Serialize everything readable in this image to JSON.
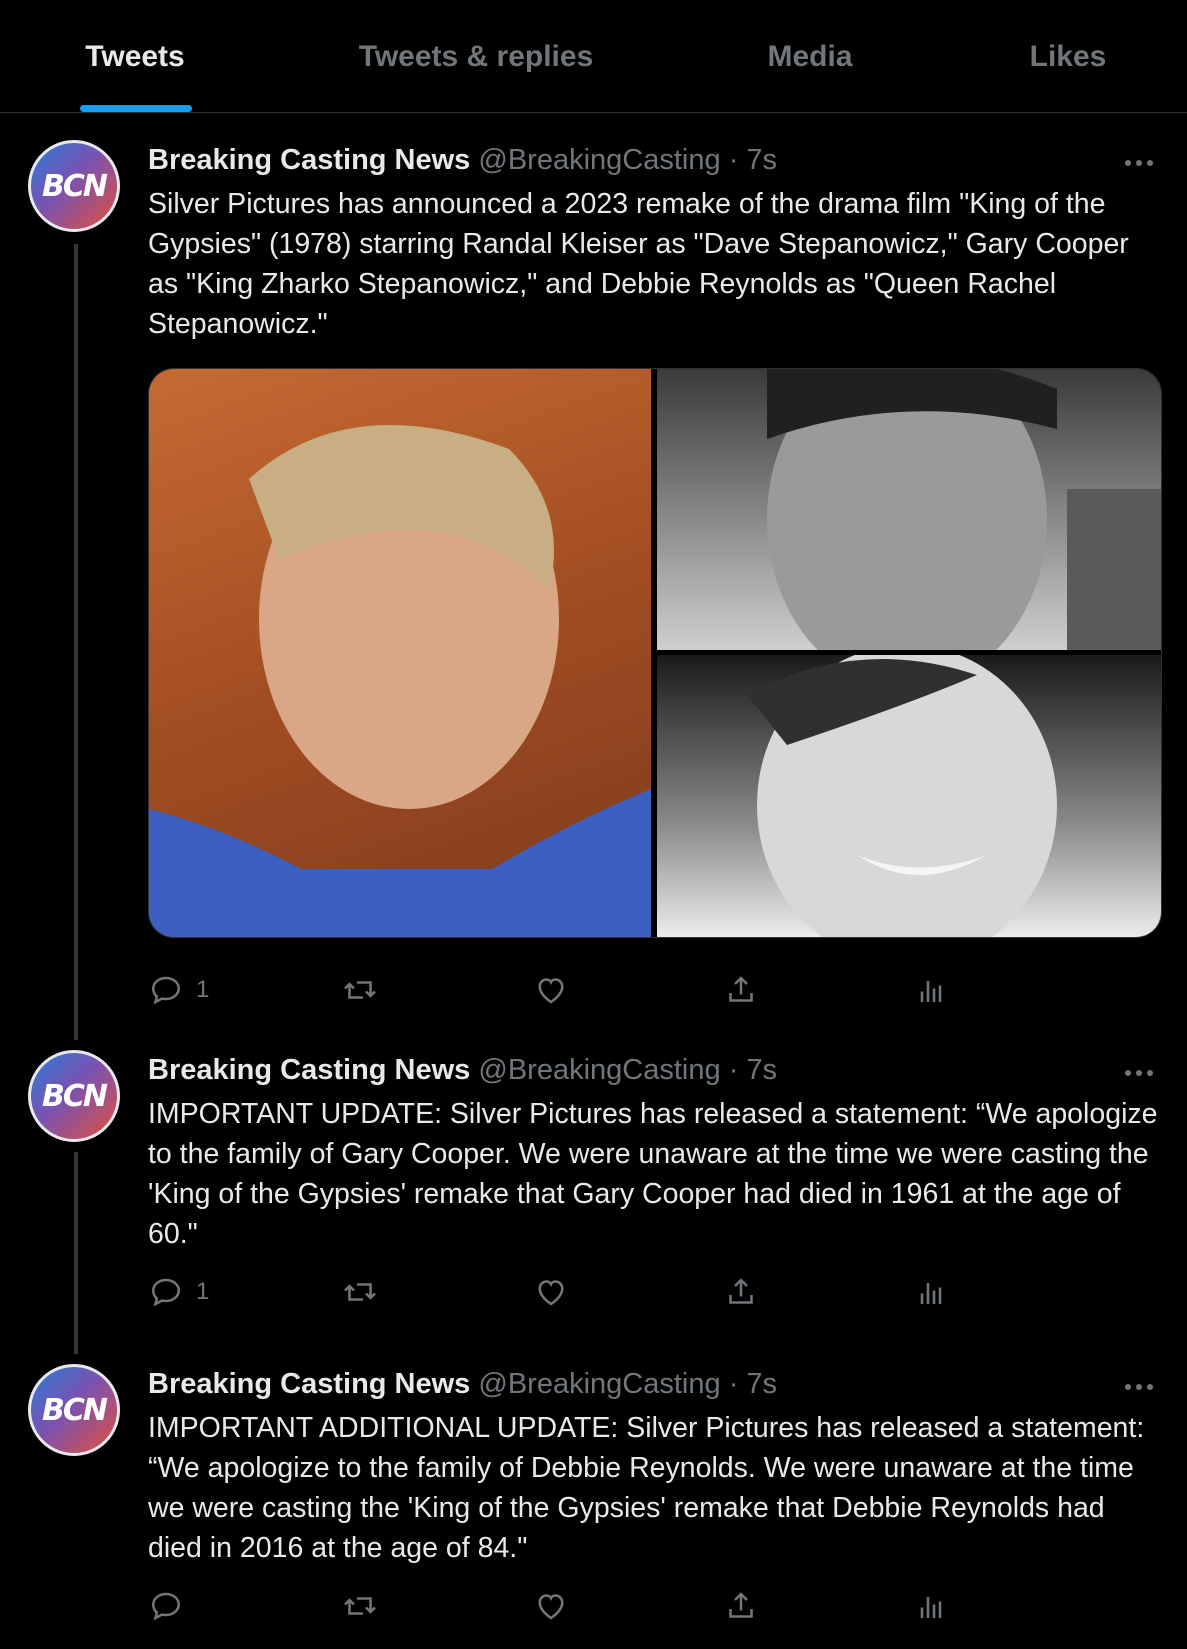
{
  "tabs": [
    {
      "label": "Tweets",
      "active": true
    },
    {
      "label": "Tweets & replies",
      "active": false
    },
    {
      "label": "Media",
      "active": false
    },
    {
      "label": "Likes",
      "active": false
    }
  ],
  "colors": {
    "accent": "#1d9bf0",
    "muted": "#71767b",
    "text": "#e7e9ea",
    "background": "#000000"
  },
  "tweets": [
    {
      "avatar_text": "BCN",
      "name": "Breaking Casting News",
      "handle": "@BreakingCasting",
      "separator": "·",
      "time": "7s",
      "text": "Silver Pictures has announced a 2023 remake of the drama film \"King of the Gypsies\" (1978) starring Randal Kleiser as \"Dave Stepanowicz,\" Gary Cooper as \"King Zharko Stepanowicz,\" and Debbie Reynolds as \"Queen Rachel Stepanowicz.\"",
      "reply_count": "1",
      "photos": [
        "photo-man-blue-shirt",
        "photo-man-black-and-white",
        "photo-woman-black-and-white"
      ]
    },
    {
      "avatar_text": "BCN",
      "name": "Breaking Casting News",
      "handle": "@BreakingCasting",
      "separator": "·",
      "time": "7s",
      "text": "IMPORTANT UPDATE: Silver Pictures has released a statement: “We apologize to the family of Gary Cooper. We were unaware at the time we were casting the 'King of the Gypsies' remake that Gary Cooper had died in 1961 at the age of 60.\"",
      "reply_count": "1"
    },
    {
      "avatar_text": "BCN",
      "name": "Breaking Casting News",
      "handle": "@BreakingCasting",
      "separator": "·",
      "time": "7s",
      "text": "IMPORTANT ADDITIONAL UPDATE: Silver Pictures has released a statement: “We apologize to the family of Debbie Reynolds. We were unaware at the time we were casting the 'King of the Gypsies' remake that Debbie Reynolds had died in 2016 at the age of 84.\"",
      "reply_count": ""
    }
  ],
  "icons": [
    "reply-icon",
    "retweet-icon",
    "like-icon",
    "share-icon",
    "analytics-icon",
    "more-icon"
  ]
}
